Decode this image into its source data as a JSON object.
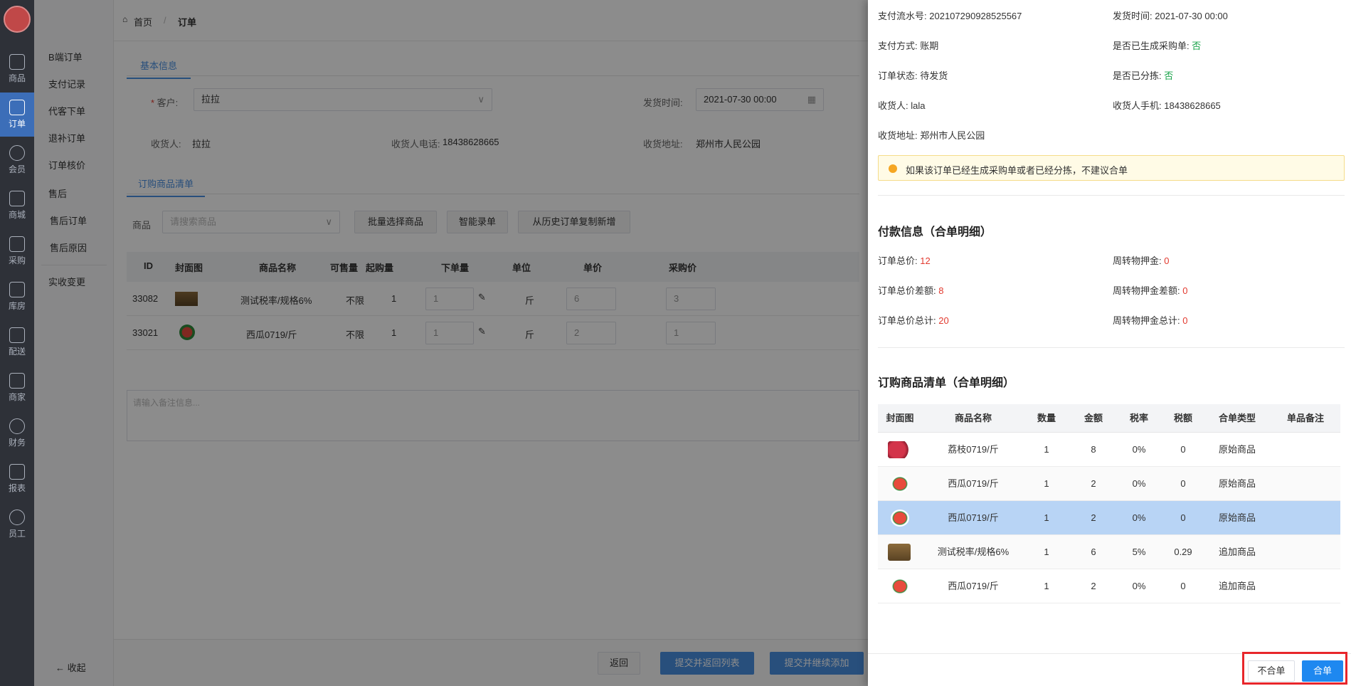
{
  "sidebar": {
    "icons": [
      {
        "label": "商品",
        "icon": "bag-icon"
      },
      {
        "label": "订单",
        "icon": "order-icon",
        "active": true
      },
      {
        "label": "会员",
        "icon": "user-icon"
      },
      {
        "label": "商城",
        "icon": "home-icon"
      },
      {
        "label": "采购",
        "icon": "purchase-icon"
      },
      {
        "label": "库房",
        "icon": "warehouse-icon"
      },
      {
        "label": "配送",
        "icon": "delivery-icon"
      },
      {
        "label": "商家",
        "icon": "store-icon"
      },
      {
        "label": "财务",
        "icon": "yen-icon"
      },
      {
        "label": "报表",
        "icon": "chart-icon"
      },
      {
        "label": "员工",
        "icon": "staff-icon"
      }
    ],
    "submenu": [
      "B端订单",
      "支付记录",
      "代客下单",
      "退补订单",
      "订单核价",
      "售后",
      "售后订单",
      "售后原因",
      "实收变更"
    ],
    "collapse": "收起"
  },
  "breadcrumb": {
    "home": "首页",
    "current": "订单"
  },
  "form": {
    "tab_basic": "基本信息",
    "customer_label": "客户:",
    "customer_value": "拉拉",
    "ship_time_label": "发货时间:",
    "ship_time_value": "2021-07-30 00:00",
    "receiver_label": "收货人:",
    "receiver_value": "拉拉",
    "receiver_phone_label": "收货人电话:",
    "receiver_phone_value": "18438628665",
    "address_label": "收货地址:",
    "address_value": "郑州市人民公园",
    "tab_goods": "订购商品清单",
    "goods_label": "商品",
    "goods_placeholder": "请搜索商品",
    "btn_batch": "批量选择商品",
    "btn_smart": "智能录单",
    "btn_history": "从历史订单复制新增",
    "table_headers": [
      "ID",
      "封面图",
      "商品名称",
      "可售量",
      "起购量",
      "下单量",
      "单位",
      "单价",
      "采购价"
    ],
    "rows": [
      {
        "id": "33082",
        "name": "测试税率/规格6%",
        "avail": "不限",
        "min": "1",
        "qty": "1",
        "unit": "斤",
        "price": "6",
        "cost": "3",
        "img": "box"
      },
      {
        "id": "33021",
        "name": "西瓜0719/斤",
        "avail": "不限",
        "min": "1",
        "qty": "1",
        "unit": "斤",
        "price": "2",
        "cost": "1",
        "img": "melon"
      }
    ],
    "remark_placeholder": "请输入备注信息...",
    "btn_back": "返回",
    "btn_submit_list": "提交并返回列表",
    "btn_submit_continue": "提交并继续添加"
  },
  "drawer": {
    "serial_label": "支付流水号:",
    "serial_value": "202107290928525567",
    "ship_label": "发货时间:",
    "ship_value": "2021-07-30 00:00",
    "pay_method_label": "支付方式:",
    "pay_method_value": "账期",
    "purchase_gen_label": "是否已生成采购单:",
    "purchase_gen_value": "否",
    "order_status_label": "订单状态:",
    "order_status_value": "待发货",
    "sorted_label": "是否已分拣:",
    "sorted_value": "否",
    "receiver_label": "收货人:",
    "receiver_value": "lala",
    "receiver_phone_label": "收货人手机:",
    "receiver_phone_value": "18438628665",
    "address_label": "收货地址:",
    "address_value": "郑州市人民公园",
    "warning": "如果该订单已经生成采购单或者已经分拣，不建议合单",
    "pay_title": "付款信息（合单明细）",
    "total_label": "订单总价:",
    "total_value": "12",
    "deposit_label": "周转物押金:",
    "deposit_value": "0",
    "diff_label": "订单总价差额:",
    "diff_value": "8",
    "deposit_diff_label": "周转物押金差额:",
    "deposit_diff_value": "0",
    "sum_label": "订单总价总计:",
    "sum_value": "20",
    "deposit_sum_label": "周转物押金总计:",
    "deposit_sum_value": "0",
    "goods_title": "订购商品清单（合单明细）",
    "table_headers": [
      "封面图",
      "商品名称",
      "数量",
      "金额",
      "税率",
      "税额",
      "合单类型",
      "单品备注"
    ],
    "rows": [
      {
        "name": "荔枝0719/斤",
        "qty": "1",
        "amount": "8",
        "rate": "0%",
        "tax": "0",
        "type": "原始商品",
        "img": "lychee"
      },
      {
        "name": "西瓜0719/斤",
        "qty": "1",
        "amount": "2",
        "rate": "0%",
        "tax": "0",
        "type": "原始商品",
        "img": "melon"
      },
      {
        "name": "西瓜0719/斤",
        "qty": "1",
        "amount": "2",
        "rate": "0%",
        "tax": "0",
        "type": "原始商品",
        "img": "melon",
        "selected": true
      },
      {
        "name": "测试税率/规格6%",
        "qty": "1",
        "amount": "6",
        "rate": "5%",
        "tax": "0.29",
        "type": "追加商品",
        "img": "box"
      },
      {
        "name": "西瓜0719/斤",
        "qty": "1",
        "amount": "2",
        "rate": "0%",
        "tax": "0",
        "type": "追加商品",
        "img": "melon"
      }
    ],
    "btn_no_merge": "不合单",
    "btn_merge": "合单"
  }
}
